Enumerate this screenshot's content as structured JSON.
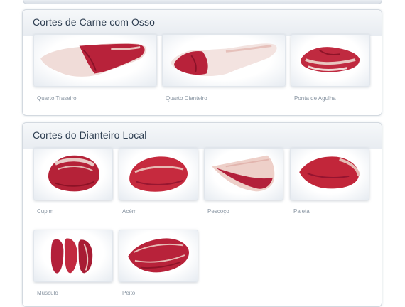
{
  "sections": [
    {
      "title": "Cortes de Carne com Osso",
      "items": [
        {
          "label": "Quarto Traseiro",
          "icon": "hindquarter-cut-image"
        },
        {
          "label": "Quarto Dianteiro",
          "icon": "forequarter-cut-image"
        },
        {
          "label": "Ponta de Agulha",
          "icon": "ponta-de-agulha-cut-image"
        }
      ]
    },
    {
      "title": "Cortes do Dianteiro Local",
      "items": [
        {
          "label": "Cupim",
          "icon": "cupim-cut-image"
        },
        {
          "label": "Acém",
          "icon": "acem-cut-image"
        },
        {
          "label": "Pescoço",
          "icon": "pescoco-cut-image"
        },
        {
          "label": "Paleta",
          "icon": "paleta-cut-image"
        },
        {
          "label": "Músculo",
          "icon": "musculo-cut-image"
        },
        {
          "label": "Peito",
          "icon": "peito-cut-image"
        }
      ]
    }
  ],
  "colors": {
    "title": "#2f3f52",
    "caption": "#8a96a3",
    "meat": "#b8223a",
    "fat": "#f1d9d6"
  }
}
